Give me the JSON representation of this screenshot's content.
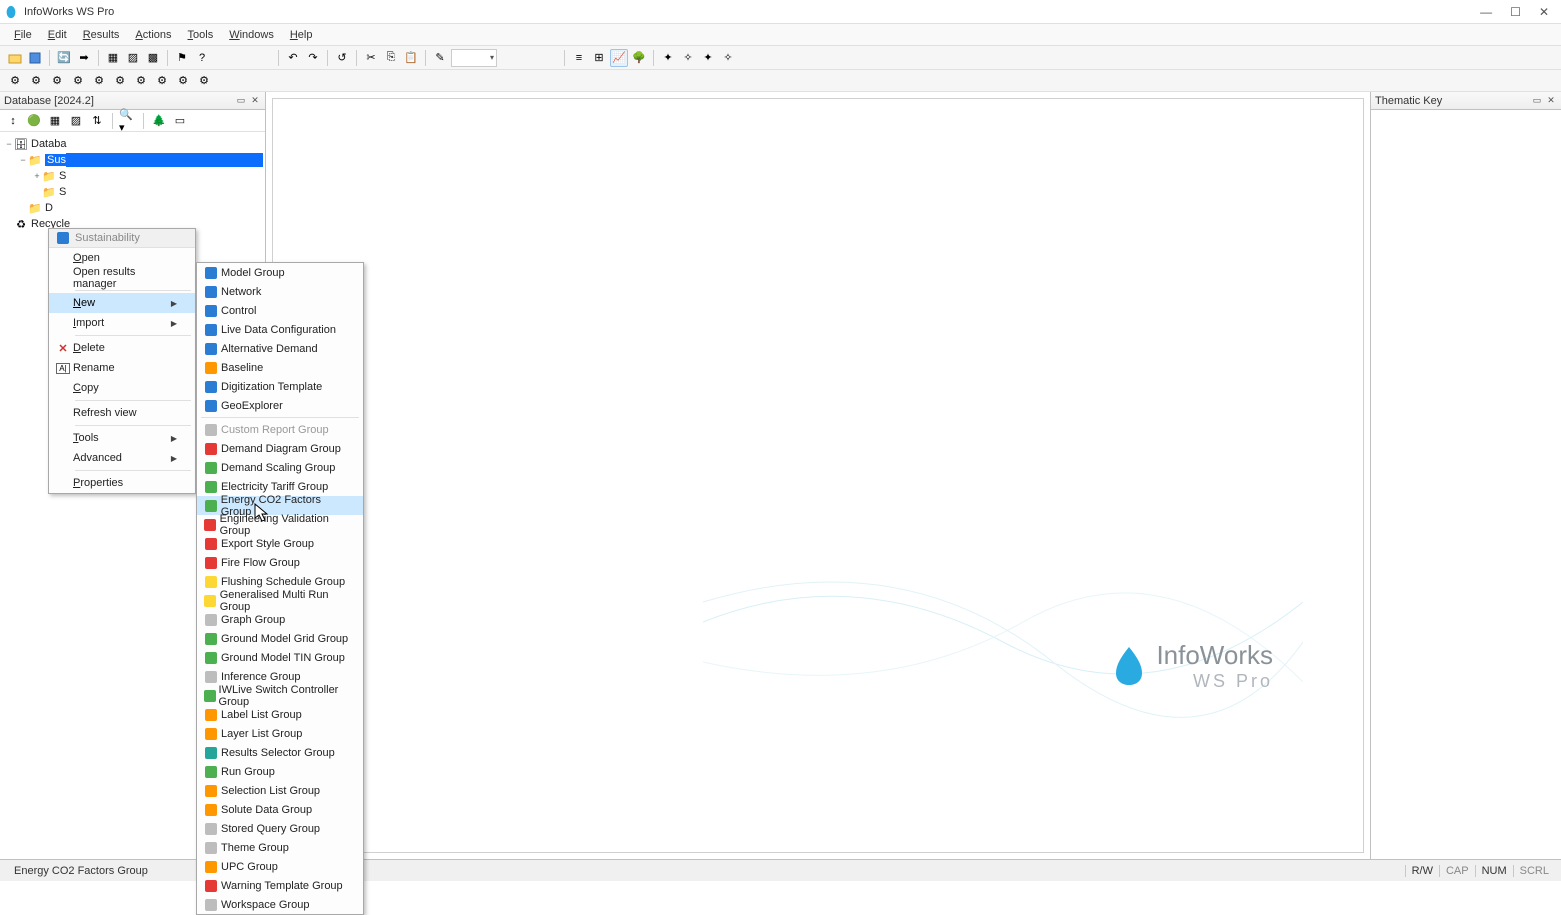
{
  "window": {
    "title": "InfoWorks WS Pro"
  },
  "menubar": [
    "File",
    "Edit",
    "Results",
    "Actions",
    "Tools",
    "Windows",
    "Help"
  ],
  "left_panel": {
    "title": "Database [2024.2]"
  },
  "tree": {
    "root": "Databa",
    "sel": "Sus",
    "n2": "S",
    "n3": "S",
    "n4": "D",
    "recycle": "Recycle"
  },
  "right_panel": {
    "title": "Thematic Key"
  },
  "ctx": {
    "header": "Sustainability",
    "items": [
      {
        "label": "Open",
        "u": "O"
      },
      {
        "label": "Open results manager"
      },
      {
        "sep": true
      },
      {
        "label": "New",
        "u": "N",
        "arrow": true,
        "hl": true
      },
      {
        "label": "Import",
        "u": "I",
        "arrow": true
      },
      {
        "sep": true
      },
      {
        "label": "Delete",
        "u": "D",
        "icon": "x"
      },
      {
        "label": "Rename",
        "icon": "rename"
      },
      {
        "label": "Copy",
        "u": "C"
      },
      {
        "sep": true
      },
      {
        "label": "Refresh view"
      },
      {
        "sep": true
      },
      {
        "label": "Tools",
        "u": "T",
        "arrow": true
      },
      {
        "label": "Advanced",
        "arrow": true
      },
      {
        "sep": true
      },
      {
        "label": "Properties",
        "u": "P"
      }
    ]
  },
  "sub": [
    {
      "label": "Model Group",
      "c": "sq-blue"
    },
    {
      "label": "Network",
      "c": "sq-blue"
    },
    {
      "label": "Control",
      "c": "sq-blue"
    },
    {
      "label": "Live Data Configuration",
      "c": "sq-blue"
    },
    {
      "label": "Alternative Demand",
      "c": "sq-blue"
    },
    {
      "label": "Baseline",
      "c": "sq-orange"
    },
    {
      "label": "Digitization Template",
      "c": "sq-blue"
    },
    {
      "label": "GeoExplorer",
      "c": "sq-blue"
    },
    {
      "sep": true
    },
    {
      "label": "Custom Report Group",
      "c": "sq-gray",
      "disabled": true
    },
    {
      "label": "Demand Diagram Group",
      "c": "sq-red"
    },
    {
      "label": "Demand Scaling Group",
      "c": "sq-green"
    },
    {
      "label": "Electricity Tariff Group",
      "c": "sq-green"
    },
    {
      "label": "Energy CO2 Factors Group",
      "c": "sq-green",
      "hl": true
    },
    {
      "label": "Engineering Validation Group",
      "c": "sq-red"
    },
    {
      "label": "Export Style Group",
      "c": "sq-red"
    },
    {
      "label": "Fire Flow Group",
      "c": "sq-red"
    },
    {
      "label": "Flushing Schedule Group",
      "c": "sq-yellow"
    },
    {
      "label": "Generalised Multi Run Group",
      "c": "sq-yellow"
    },
    {
      "label": "Graph Group",
      "c": "sq-gray"
    },
    {
      "label": "Ground Model Grid Group",
      "c": "sq-green"
    },
    {
      "label": "Ground Model TIN Group",
      "c": "sq-green"
    },
    {
      "label": "Inference Group",
      "c": "sq-gray"
    },
    {
      "label": "IWLive Switch Controller Group",
      "c": "sq-green"
    },
    {
      "label": "Label List Group",
      "c": "sq-orange"
    },
    {
      "label": "Layer List Group",
      "c": "sq-orange"
    },
    {
      "label": "Results Selector Group",
      "c": "sq-teal"
    },
    {
      "label": "Run Group",
      "c": "sq-green"
    },
    {
      "label": "Selection List Group",
      "c": "sq-orange"
    },
    {
      "label": "Solute Data Group",
      "c": "sq-orange"
    },
    {
      "label": "Stored Query Group",
      "c": "sq-gray"
    },
    {
      "label": "Theme Group",
      "c": "sq-gray"
    },
    {
      "label": "UPC Group",
      "c": "sq-orange"
    },
    {
      "label": "Warning Template Group",
      "c": "sq-red"
    },
    {
      "label": "Workspace Group",
      "c": "sq-gray"
    }
  ],
  "status": {
    "left": "Energy CO2 Factors Group",
    "rw": "R/W",
    "cap": "CAP",
    "num": "NUM",
    "scrl": "SCRL"
  },
  "logo": {
    "name": "InfoWorks",
    "sub": "WS Pro"
  }
}
